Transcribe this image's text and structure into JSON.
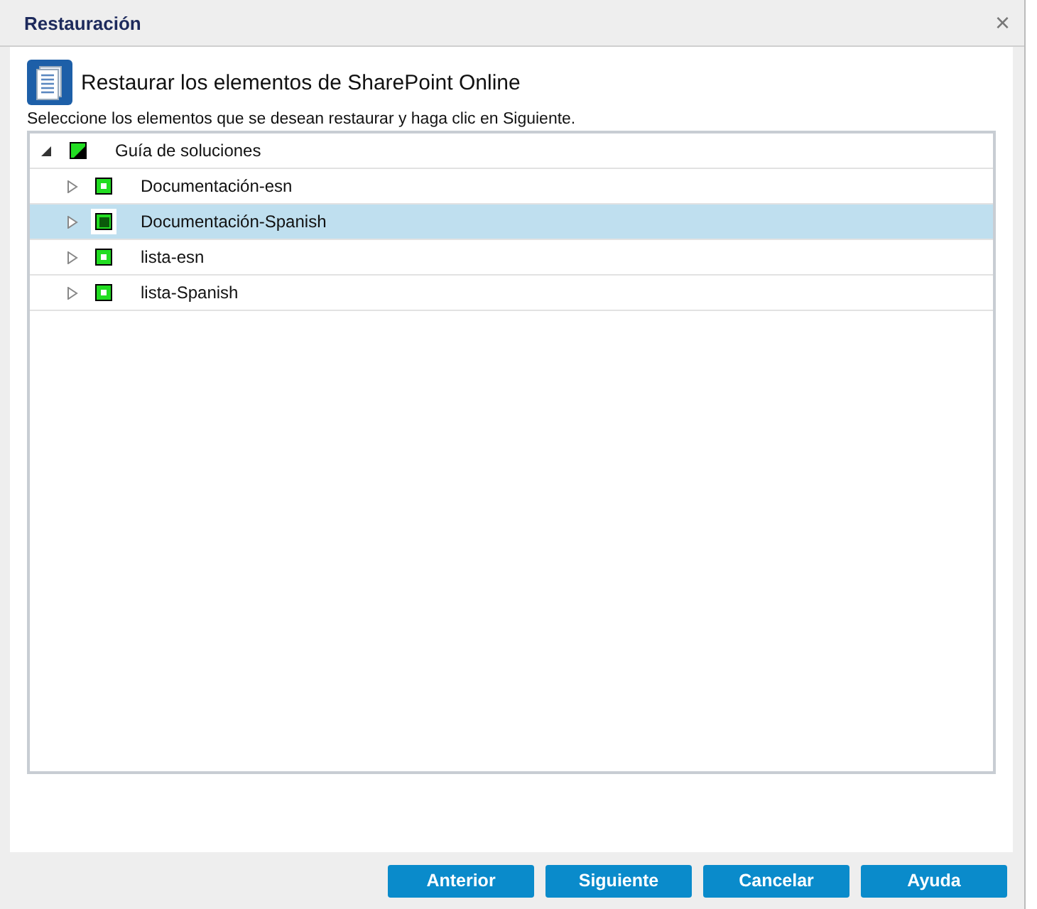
{
  "window": {
    "title": "Restauración",
    "close": "×"
  },
  "heading": "Restaurar los elementos de SharePoint Online",
  "instruction": "Seleccione los elementos que se desean restaurar y haga clic en Siguiente.",
  "tree": [
    {
      "label": "Guía de soluciones",
      "expanded": true,
      "checked": false,
      "partial": true,
      "selected": false,
      "children": [
        {
          "label": "Documentación-esn",
          "expanded": false,
          "checked": false,
          "partial": false,
          "selected": false
        },
        {
          "label": "Documentación-Spanish",
          "expanded": false,
          "checked": true,
          "partial": false,
          "selected": true
        },
        {
          "label": "lista-esn",
          "expanded": false,
          "checked": false,
          "partial": false,
          "selected": false
        },
        {
          "label": "lista-Spanish",
          "expanded": false,
          "checked": false,
          "partial": false,
          "selected": false
        }
      ]
    }
  ],
  "buttons": [
    "Anterior",
    "Siguiente",
    "Cancelar",
    "Ayuda"
  ]
}
